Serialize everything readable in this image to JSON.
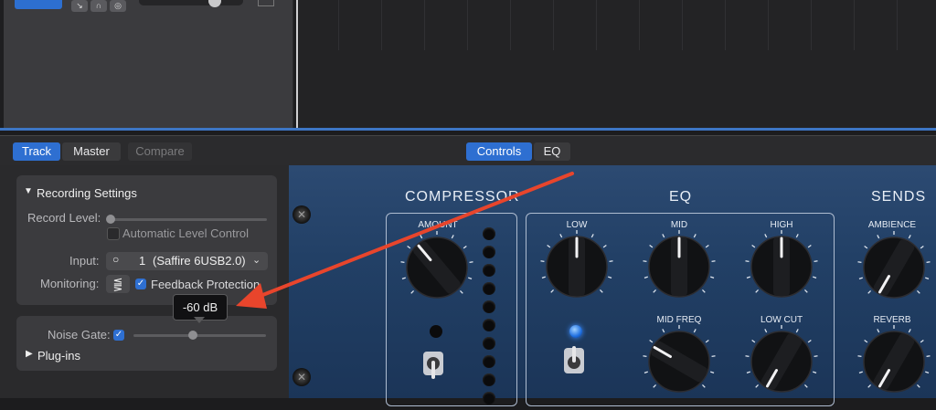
{
  "editor_tabs": {
    "track": "Track",
    "master": "Master",
    "compare": "Compare",
    "controls": "Controls",
    "eq": "EQ"
  },
  "recording_settings": {
    "header": "Recording Settings",
    "record_level_label": "Record Level:",
    "automatic_level_control": "Automatic Level Control",
    "automatic_level_control_checked": false,
    "input_label": "Input:",
    "input_channel": "1",
    "input_device": "(Saffire 6USB2.0)",
    "monitoring_label": "Monitoring:",
    "feedback_protection": "Feedback Protection",
    "feedback_protection_checked": true
  },
  "noise_gate": {
    "label": "Noise Gate:",
    "enabled": true,
    "value_tooltip": "-60 dB",
    "level_fraction": 0.45
  },
  "plugins": {
    "label": "Plug-ins"
  },
  "amp": {
    "compressor_title": "COMPRESSOR",
    "eq_title": "EQ",
    "sends_title": "SENDS",
    "amount_label": "AMOUNT",
    "low_label": "LOW",
    "mid_label": "MID",
    "high_label": "HIGH",
    "mid_freq_label": "MID FREQ",
    "low_cut_label": "LOW CUT",
    "ambience_label": "AMBIENCE",
    "reverb_label": "REVERB"
  },
  "colors": {
    "accent": "#2e6fd1",
    "annotation_arrow": "#e8452c"
  }
}
